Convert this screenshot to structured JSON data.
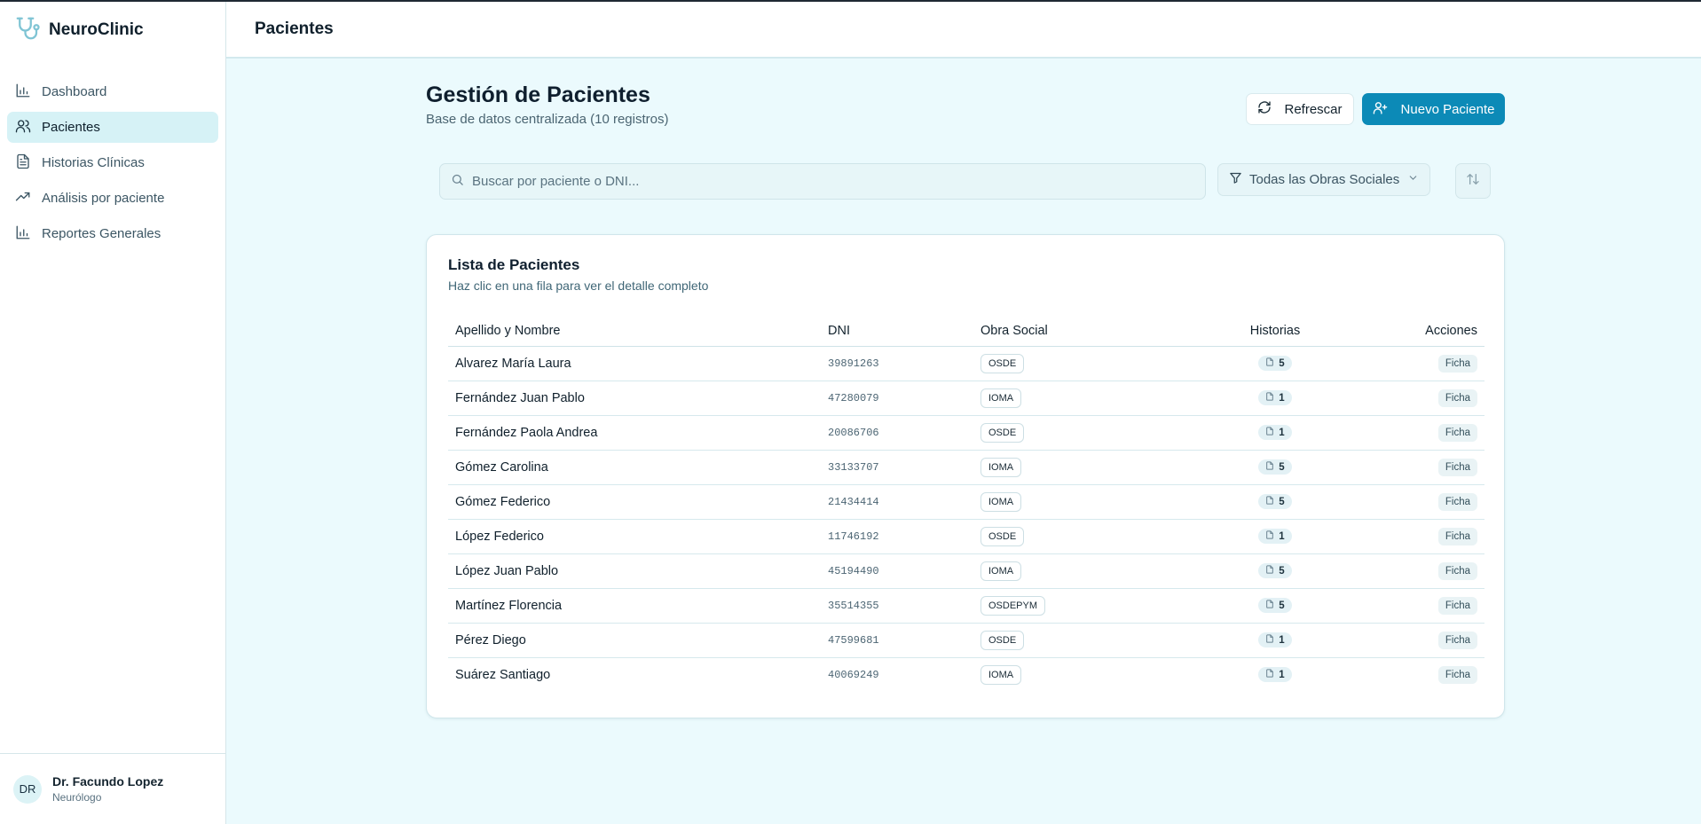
{
  "app": {
    "name": "NeuroClinic",
    "logo_icon": "stethoscope-icon"
  },
  "sidebar": {
    "items": [
      {
        "label": "Dashboard",
        "icon": "bar-chart-icon",
        "active": false
      },
      {
        "label": "Pacientes",
        "icon": "users-icon",
        "active": true
      },
      {
        "label": "Historias Clínicas",
        "icon": "file-text-icon",
        "active": false
      },
      {
        "label": "Análisis por paciente",
        "icon": "trending-up-icon",
        "active": false
      },
      {
        "label": "Reportes Generales",
        "icon": "bar-chart-icon",
        "active": false
      }
    ]
  },
  "user": {
    "initials": "DR",
    "name": "Dr. Facundo Lopez",
    "role": "Neurólogo"
  },
  "topbar": {
    "title": "Pacientes"
  },
  "page": {
    "title": "Gestión de Pacientes",
    "subtitle": "Base de datos centralizada (10 registros)",
    "refresh_label": "Refrescar",
    "new_label": "Nuevo Paciente"
  },
  "search": {
    "placeholder": "Buscar por paciente o DNI..."
  },
  "filter": {
    "label": "Todas las Obras Sociales"
  },
  "card": {
    "title": "Lista de Pacientes",
    "subtitle": "Haz clic en una fila para ver el detalle completo"
  },
  "table": {
    "headers": [
      "Apellido y Nombre",
      "DNI",
      "Obra Social",
      "Historias",
      "Acciones"
    ],
    "rows": [
      {
        "name": "Alvarez María Laura",
        "dni": "39891263",
        "obra": "OSDE",
        "historias": "5",
        "accion": "Ficha"
      },
      {
        "name": "Fernández Juan Pablo",
        "dni": "47280079",
        "obra": "IOMA",
        "historias": "1",
        "accion": "Ficha"
      },
      {
        "name": "Fernández Paola Andrea",
        "dni": "20086706",
        "obra": "OSDE",
        "historias": "1",
        "accion": "Ficha"
      },
      {
        "name": "Gómez Carolina",
        "dni": "33133707",
        "obra": "IOMA",
        "historias": "5",
        "accion": "Ficha"
      },
      {
        "name": "Gómez Federico",
        "dni": "21434414",
        "obra": "IOMA",
        "historias": "5",
        "accion": "Ficha"
      },
      {
        "name": "López Federico",
        "dni": "11746192",
        "obra": "OSDE",
        "historias": "1",
        "accion": "Ficha"
      },
      {
        "name": "López Juan Pablo",
        "dni": "45194490",
        "obra": "IOMA",
        "historias": "5",
        "accion": "Ficha"
      },
      {
        "name": "Martínez Florencia",
        "dni": "35514355",
        "obra": "OSDEPYM",
        "historias": "5",
        "accion": "Ficha"
      },
      {
        "name": "Pérez Diego",
        "dni": "47599681",
        "obra": "OSDE",
        "historias": "1",
        "accion": "Ficha"
      },
      {
        "name": "Suárez Santiago",
        "dni": "40069249",
        "obra": "IOMA",
        "historias": "1",
        "accion": "Ficha"
      }
    ]
  },
  "colors": {
    "accent": "#0c8ab7",
    "background": "#ebfafd",
    "active_nav": "#d6f2f6"
  }
}
